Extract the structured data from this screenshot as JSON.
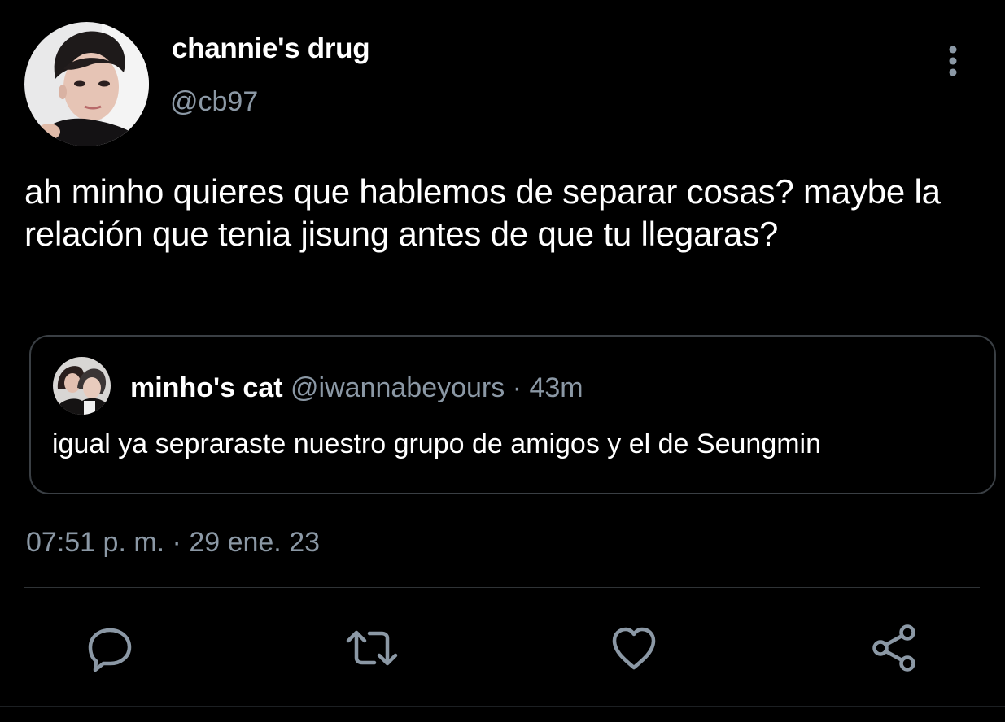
{
  "author": {
    "display_name": "channie's drug",
    "handle": "@cb97"
  },
  "tweet": {
    "text": "ah minho quieres que hablemos de separar cosas? maybe la relación que tenia jisung antes de que tu llegaras?",
    "timestamp": "07:51 p. m. · 29 ene. 23"
  },
  "quoted": {
    "display_name": "minho's cat",
    "handle": "@iwannabeyours",
    "time": " · 43m",
    "text": "igual ya sepraraste nuestro grupo de amigos y el de Seungmin"
  },
  "icons": {
    "more": "more-vertical-icon",
    "reply": "reply-icon",
    "retweet": "retweet-icon",
    "like": "heart-icon",
    "share": "share-icon"
  },
  "colors": {
    "background": "#000000",
    "primary_text": "#ffffff",
    "secondary_text": "#8b98a5",
    "border": "#3a3f44",
    "icon": "#8b98a5"
  }
}
